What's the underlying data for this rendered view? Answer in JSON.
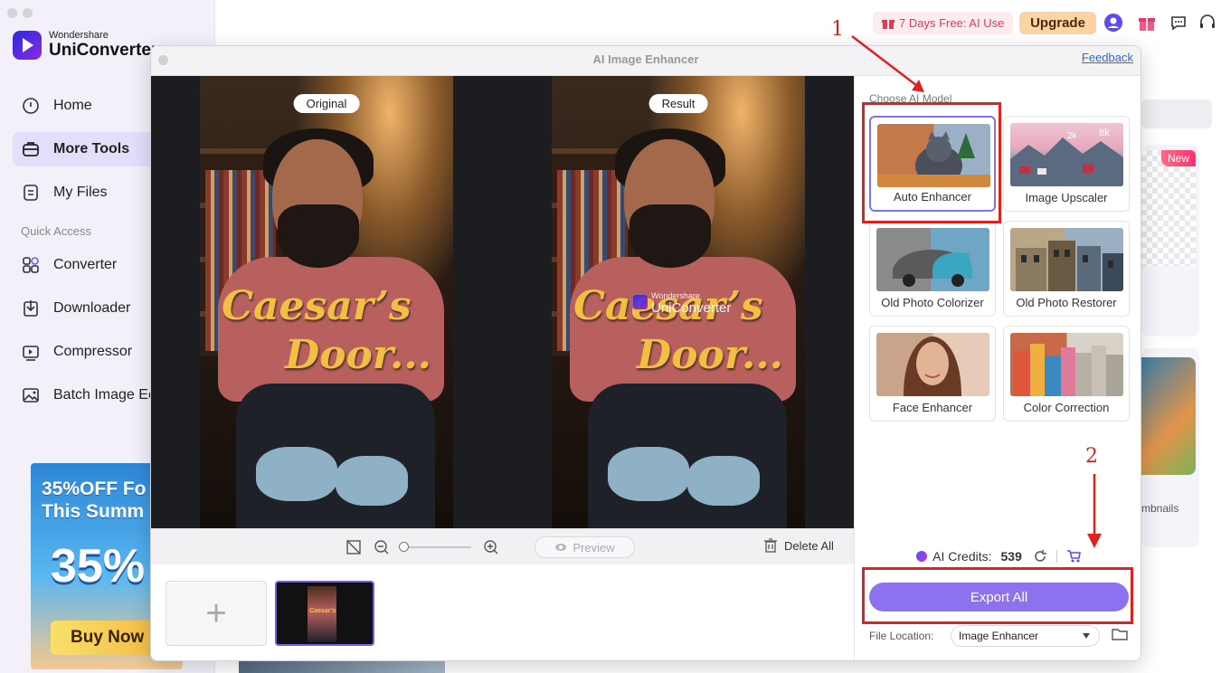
{
  "app": {
    "brand_small": "Wondershare",
    "brand_big": "UniConverter",
    "accent": "#8d72f0",
    "annotation_color": "#e0211f"
  },
  "sidebar": {
    "items": [
      {
        "label": "Home",
        "icon": "home-icon"
      },
      {
        "label": "More Tools",
        "icon": "toolbox-icon",
        "active": true
      },
      {
        "label": "My Files",
        "icon": "file-icon"
      }
    ],
    "quick_access_label": "Quick Access",
    "quick_items": [
      {
        "label": "Converter",
        "icon": "converter-icon"
      },
      {
        "label": "Downloader",
        "icon": "downloader-icon"
      },
      {
        "label": "Compressor",
        "icon": "compressor-icon"
      },
      {
        "label": "Batch Image Ec",
        "icon": "batch-image-icon"
      }
    ],
    "promo": {
      "line1": "35%OFF Fo",
      "line2": "This Summ",
      "big": "35%",
      "button": "Buy Now"
    }
  },
  "topbar": {
    "free_trial": "7 Days Free: AI Use",
    "upgrade": "Upgrade"
  },
  "background": {
    "new_badge": "New",
    "card_text": "mbnails"
  },
  "modal": {
    "title": "AI Image Enhancer",
    "feedback": "Feedback",
    "original_label": "Original",
    "result_label": "Result",
    "caption_line1": "Caesar’s",
    "caption_line2": "Door...",
    "watermark_small": "Wondershare",
    "watermark_big": "UniConverter",
    "preview_button": "Preview",
    "delete_all": "Delete All",
    "add_symbol": "+"
  },
  "panel": {
    "choose_label": "Choose AI Model",
    "models": [
      {
        "label": "Auto Enhancer",
        "selected": true
      },
      {
        "label": "Image Upscaler"
      },
      {
        "label": "Old Photo Colorizer"
      },
      {
        "label": "Old Photo Restorer"
      },
      {
        "label": "Face Enhancer"
      },
      {
        "label": "Color Correction"
      }
    ],
    "credits_label": "AI Credits:",
    "credits_value": "539",
    "export_all": "Export All",
    "file_location_label": "File Location:",
    "file_location_value": "Image Enhancer",
    "upscaler_tags": [
      "2k",
      "8k"
    ]
  },
  "annotations": {
    "step1": "1",
    "step2": "2"
  }
}
